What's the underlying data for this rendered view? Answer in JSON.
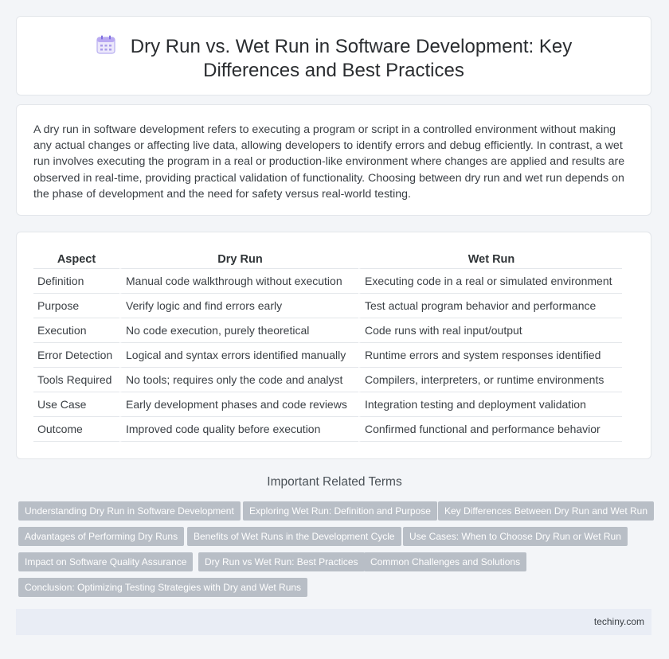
{
  "header": {
    "title": "Dry Run vs. Wet Run in Software Development: Key Differences and Best Practices",
    "icon": "calendar-icon"
  },
  "intro": {
    "text": "A dry run in software development refers to executing a program or script in a controlled environment without making any actual changes or affecting live data, allowing developers to identify errors and debug efficiently. In contrast, a wet run involves executing the program in a real or production-like environment where changes are applied and results are observed in real-time, providing practical validation of functionality. Choosing between dry run and wet run depends on the phase of development and the need for safety versus real-world testing."
  },
  "table": {
    "headers": [
      "Aspect",
      "Dry Run",
      "Wet Run"
    ],
    "rows": [
      [
        "Definition",
        "Manual code walkthrough without execution",
        "Executing code in a real or simulated environment"
      ],
      [
        "Purpose",
        "Verify logic and find errors early",
        "Test actual program behavior and performance"
      ],
      [
        "Execution",
        "No code execution, purely theoretical",
        "Code runs with real input/output"
      ],
      [
        "Error Detection",
        "Logical and syntax errors identified manually",
        "Runtime errors and system responses identified"
      ],
      [
        "Tools Required",
        "No tools; requires only the code and analyst",
        "Compilers, interpreters, or runtime environments"
      ],
      [
        "Use Case",
        "Early development phases and code reviews",
        "Integration testing and deployment validation"
      ],
      [
        "Outcome",
        "Improved code quality before execution",
        "Confirmed functional and performance behavior"
      ]
    ]
  },
  "related": {
    "title": "Important Related Terms",
    "tags": [
      "Understanding Dry Run in Software Development",
      "Exploring Wet Run: Definition and Purpose",
      "Key Differences Between Dry Run and Wet Run",
      "Advantages of Performing Dry Runs",
      "Benefits of Wet Runs in the Development Cycle",
      "Use Cases: When to Choose Dry Run or Wet Run",
      "Impact on Software Quality Assurance",
      "Dry Run vs Wet Run: Best Practices",
      "Common Challenges and Solutions",
      "Conclusion: Optimizing Testing Strategies with Dry and Wet Runs"
    ]
  },
  "footer": {
    "site": "techiny.com"
  },
  "colors": {
    "tag_bg": "#b8bec6",
    "footer_bg": "#e9edf5",
    "page_bg": "#f3f5f8"
  }
}
